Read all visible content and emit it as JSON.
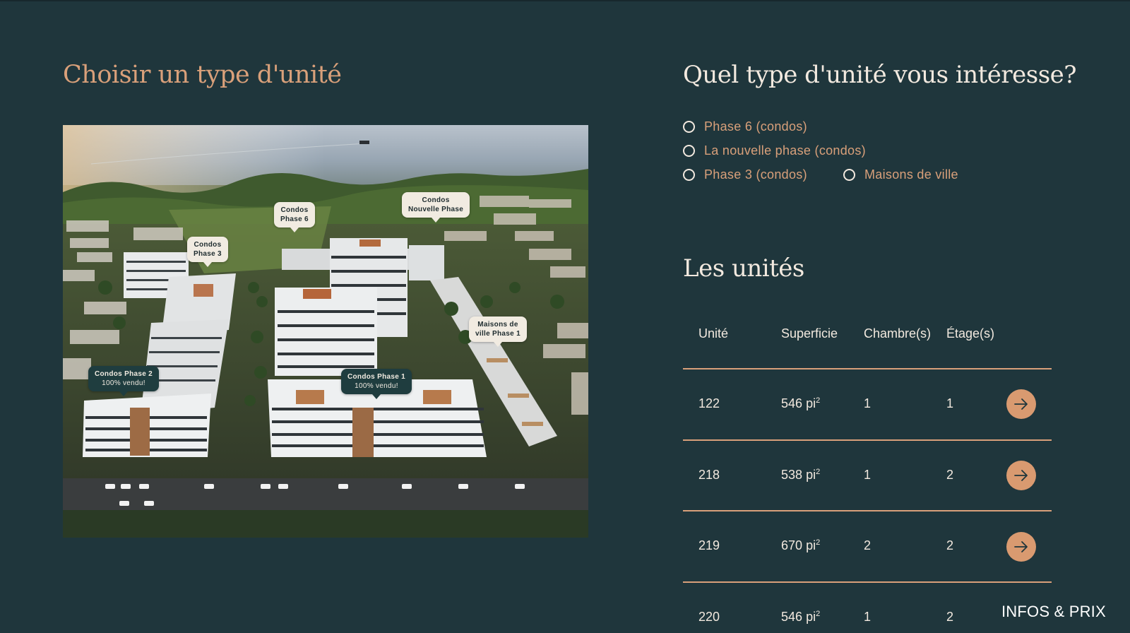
{
  "left_title": "Choisir un type d'unité",
  "right_title": "Quel type d'unité vous intéresse?",
  "units_title": "Les unités",
  "map_labels": {
    "phase6": [
      "Condos",
      "Phase 6"
    ],
    "nouvelle": [
      "Condos",
      "Nouvelle Phase"
    ],
    "phase3": [
      "Condos",
      "Phase 3"
    ],
    "maisons": [
      "Maisons de",
      "ville Phase 1"
    ],
    "phase2": [
      "Condos Phase 2",
      "100% vendu!"
    ],
    "phase1": [
      "Condos Phase 1",
      "100% vendu!"
    ]
  },
  "options": [
    {
      "label": "Phase 6 (condos)",
      "selected": false
    },
    {
      "label": "La nouvelle phase (condos)",
      "selected": false
    },
    {
      "label": "Phase 3 (condos)",
      "selected": false
    },
    {
      "label": "Maisons de ville",
      "selected": false
    }
  ],
  "table": {
    "headers": [
      "Unité",
      "Superficie",
      "Chambre(s)",
      "Étage(s)"
    ],
    "area_unit": "pi",
    "area_exp": "2",
    "rows": [
      {
        "unit": "122",
        "area": "546",
        "bedrooms": "1",
        "floor": "1"
      },
      {
        "unit": "218",
        "area": "538",
        "bedrooms": "1",
        "floor": "2"
      },
      {
        "unit": "219",
        "area": "670",
        "bedrooms": "2",
        "floor": "2"
      },
      {
        "unit": "220",
        "area": "546",
        "bedrooms": "1",
        "floor": "2"
      }
    ]
  },
  "cta_label": "INFOS & PRIX",
  "colors": {
    "background": "#1f363c",
    "accent": "#d9a07a",
    "text": "#f2e9df"
  },
  "icons": {
    "row_action": "arrow-right-icon"
  }
}
